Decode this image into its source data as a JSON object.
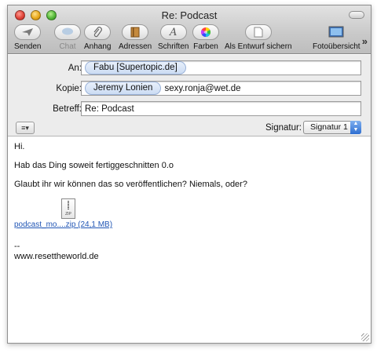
{
  "window": {
    "title": "Re: Podcast"
  },
  "toolbar": {
    "items": [
      {
        "label": "Senden",
        "icon": "send-icon"
      },
      {
        "label": "Chat",
        "icon": "chat-icon"
      },
      {
        "label": "Anhang",
        "icon": "paperclip-icon"
      },
      {
        "label": "Adressen",
        "icon": "address-book-icon"
      },
      {
        "label": "Schriften",
        "icon": "fonts-icon"
      },
      {
        "label": "Farben",
        "icon": "color-wheel-icon"
      },
      {
        "label": "Als Entwurf sichern",
        "icon": "draft-icon"
      },
      {
        "label": "Fotoübersicht",
        "icon": "photo-browser-icon"
      }
    ]
  },
  "headers": {
    "to_label": "An:",
    "to_tokens": [
      "Fabu [Supertopic.de]"
    ],
    "cc_label": "Kopie:",
    "cc_tokens": [
      "Jeremy Lonien"
    ],
    "cc_text": "sexy.ronja@wet.de",
    "subject_label": "Betreff:",
    "subject_value": "Re: Podcast",
    "signature_label": "Signatur:",
    "signature_value": "Signatur 1"
  },
  "message": {
    "greeting": "Hi.",
    "line1": "Hab das Ding soweit fertiggeschnitten 0.o",
    "line2": "Glaubt ihr wir können das so veröffentlichen? Niemals, oder?",
    "attachment_icon_label": "ZIP",
    "attachment_name": "podcast_mo....zip (24,1 MB)",
    "sig_dash": "--",
    "sig_url": "www.resettheworld.de"
  }
}
